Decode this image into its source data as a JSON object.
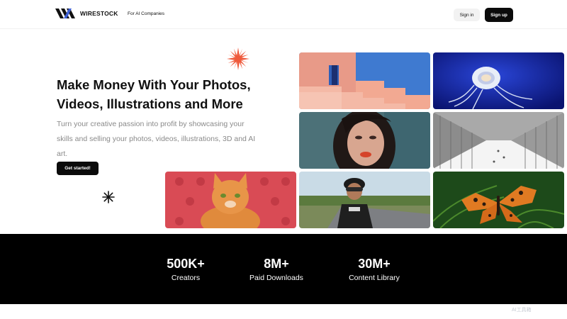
{
  "header": {
    "logo_text": "WIRESTOCK",
    "nav_link": "For AI Companies",
    "signin_label": "Sign in",
    "signup_label": "Sign up"
  },
  "hero": {
    "title": "Make Money With Your Photos, Videos, Illustrations and More",
    "subtitle": "Turn your creative passion into profit by showcasing your skills and selling your photos, videos, illustrations, 3D and AI art.",
    "cta_label": "Get started!",
    "accent_color": "#ef5a3c"
  },
  "stats": [
    {
      "value": "500K+",
      "label": "Creators"
    },
    {
      "value": "8M+",
      "label": "Paid Downloads"
    },
    {
      "value": "30M+",
      "label": "Content Library"
    }
  ],
  "gallery": [
    "pink-architecture",
    "jellyfish",
    "woman-portrait",
    "white-tunnel",
    "orange-cat",
    "cyclist",
    "butterfly"
  ],
  "watermark": "AI工具箱"
}
